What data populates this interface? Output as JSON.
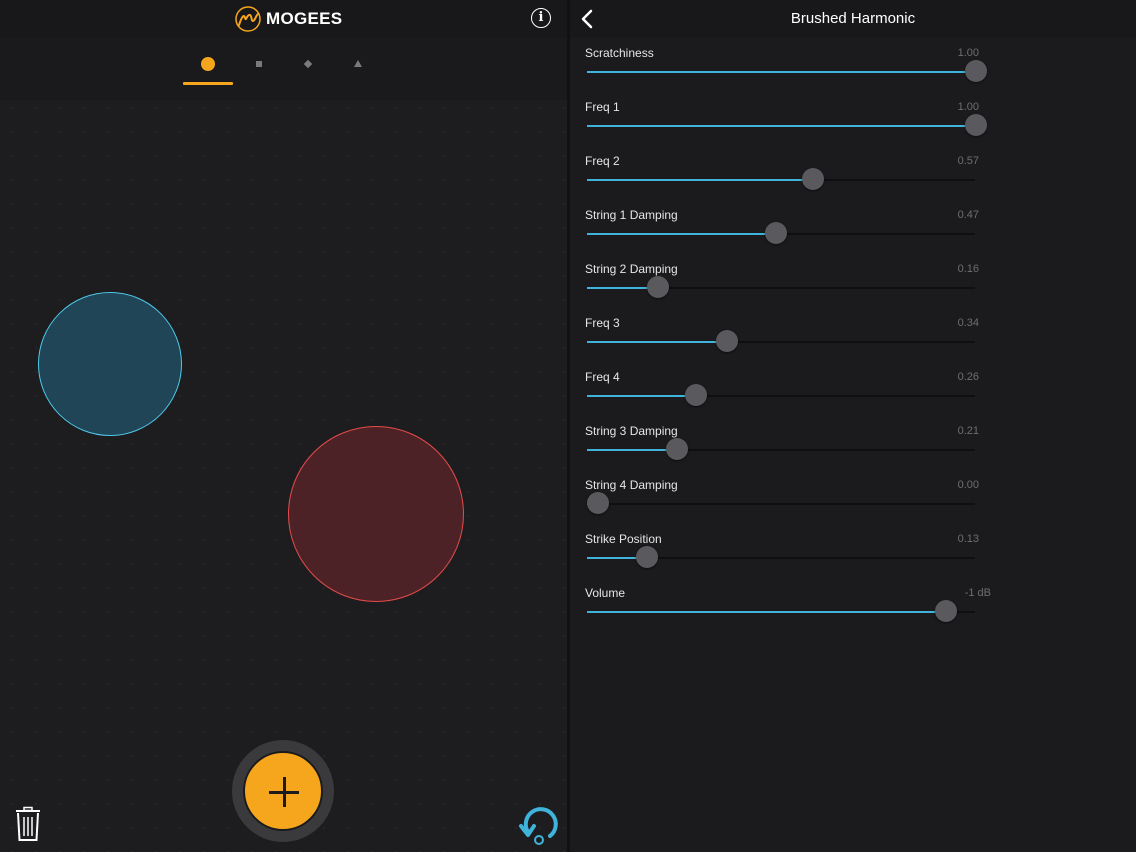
{
  "app": {
    "brand": "MOGEES",
    "info_label": "i"
  },
  "shape_tabs": [
    {
      "icon": "circle-icon",
      "selected": true
    },
    {
      "icon": "square-icon",
      "selected": false
    },
    {
      "icon": "diamond-icon",
      "selected": false
    },
    {
      "icon": "triangle-icon",
      "selected": false
    }
  ],
  "pads": [
    {
      "icon": "blue-circle-pad",
      "color": "#4fc8ea"
    },
    {
      "icon": "red-circle-pad",
      "color": "#e64b4b"
    }
  ],
  "toolbar": {
    "add_icon": "plus-icon",
    "trash_icon": "trash-icon",
    "loop_icon": "loop-icon"
  },
  "preset": {
    "title": "Brushed Harmonic",
    "back_icon": "chevron-left-icon"
  },
  "params": [
    {
      "label": "Scratchiness",
      "value": "1.00",
      "level": 1.0
    },
    {
      "label": "Freq 1",
      "value": "1.00",
      "level": 1.0
    },
    {
      "label": "Freq 2",
      "value": "0.57",
      "level": 0.57
    },
    {
      "label": "String 1 Damping",
      "value": "0.47",
      "level": 0.47
    },
    {
      "label": "String 2 Damping",
      "value": "0.16",
      "level": 0.16
    },
    {
      "label": "Freq 3",
      "value": "0.34",
      "level": 0.34
    },
    {
      "label": "Freq 4",
      "value": "0.26",
      "level": 0.26
    },
    {
      "label": "String 3 Damping",
      "value": "0.21",
      "level": 0.21
    },
    {
      "label": "String 4 Damping",
      "value": "0.00",
      "level": 0.0
    },
    {
      "label": "Strike Position",
      "value": "0.13",
      "level": 0.13
    },
    {
      "label": "Volume",
      "value": "-1 dB",
      "level": 0.92
    }
  ],
  "colors": {
    "accent": "#f5a61d",
    "slider_fill": "#3fb3d9",
    "background": "#1b1b1d"
  }
}
